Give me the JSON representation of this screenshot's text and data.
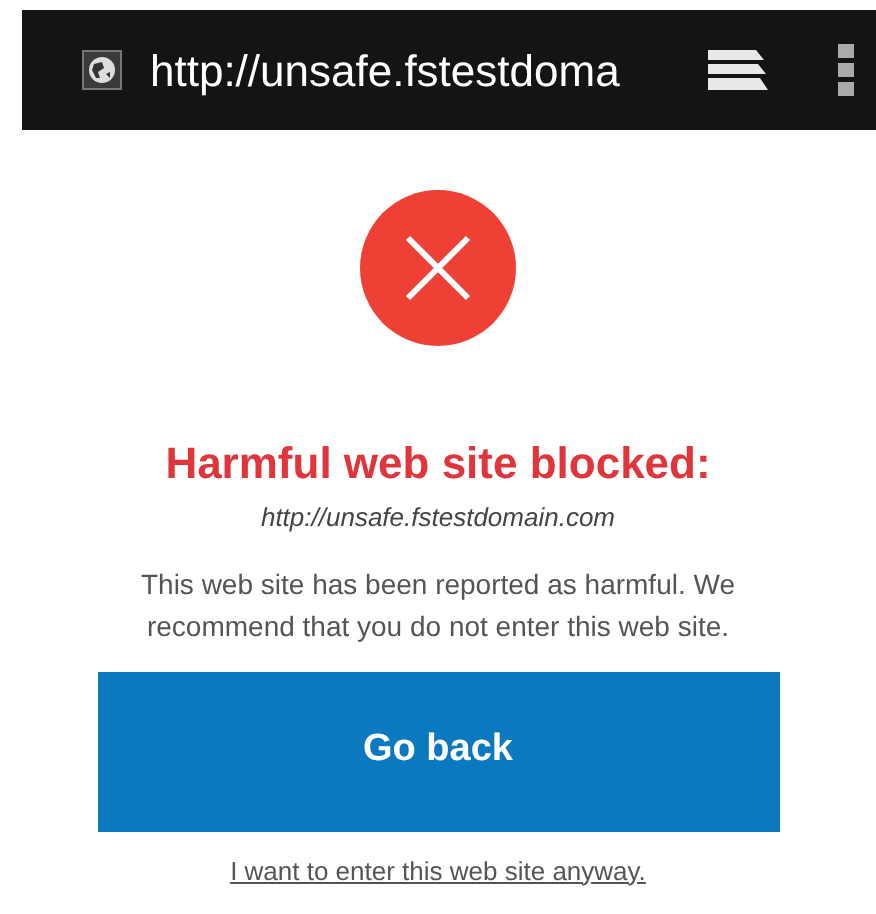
{
  "address_bar": {
    "url": "http://unsafe.fstestdoma"
  },
  "warning": {
    "title": "Harmful web site blocked:",
    "url": "http://unsafe.fstestdomain.com",
    "message": "This web site has been reported as harmful. We recommend that you do not enter this web site."
  },
  "buttons": {
    "primary": "Go back",
    "link": "I want to enter this web site anyway."
  }
}
